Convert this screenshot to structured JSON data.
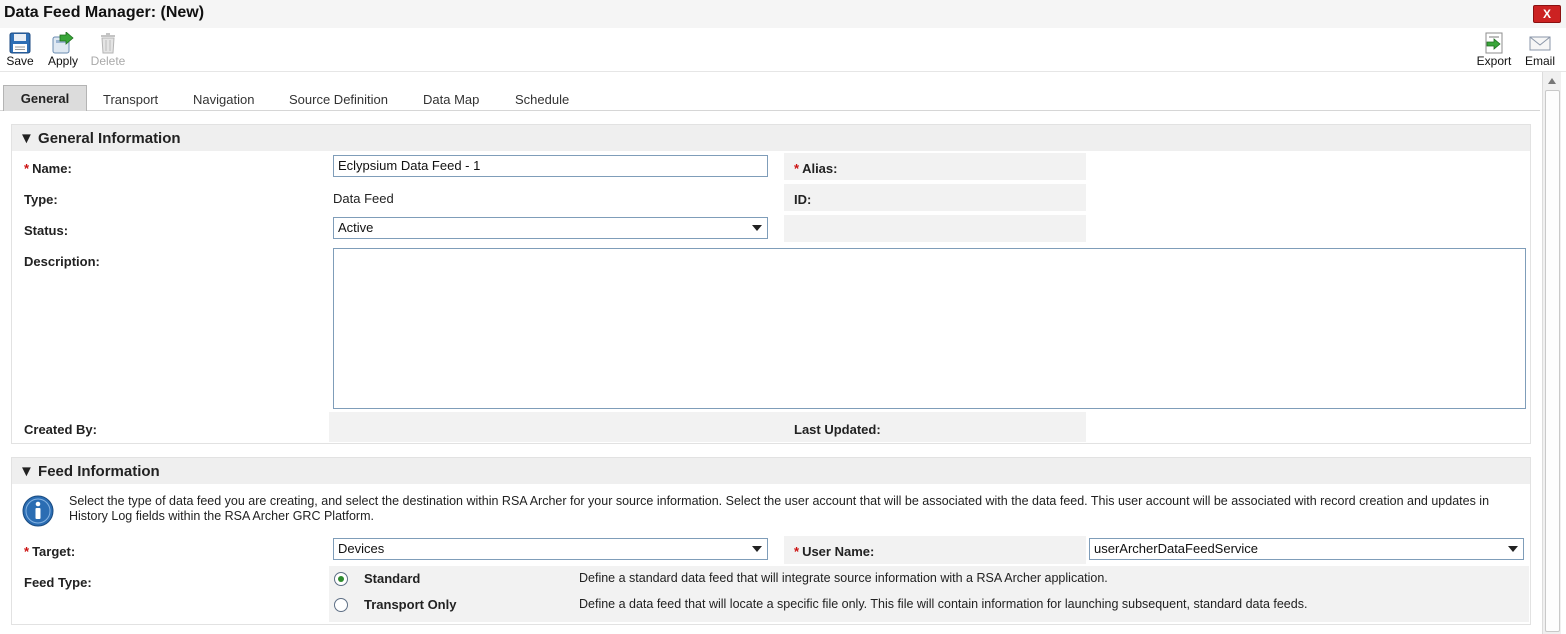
{
  "window": {
    "title": "Data Feed Manager: (New)",
    "close_label": "X"
  },
  "toolbar": {
    "save": "Save",
    "apply": "Apply",
    "delete": "Delete",
    "export": "Export",
    "email": "Email"
  },
  "tabs": [
    "General",
    "Transport",
    "Navigation",
    "Source Definition",
    "Data Map",
    "Schedule"
  ],
  "general_info": {
    "header": "General Information",
    "name_label": "Name:",
    "name_value": "Eclypsium Data Feed - 1",
    "alias_label": "Alias:",
    "type_label": "Type:",
    "type_value": "Data Feed",
    "id_label": "ID:",
    "status_label": "Status:",
    "status_value": "Active",
    "description_label": "Description:",
    "created_by_label": "Created By:",
    "last_updated_label": "Last Updated:"
  },
  "feed_info": {
    "header": "Feed Information",
    "info_text": "Select the type of data feed you are creating, and select the destination within RSA Archer for your source information. Select the user account that will be associated with the data feed. This user account will be associated with record creation and updates in History Log fields within the RSA Archer GRC Platform.",
    "target_label": "Target:",
    "target_value": "Devices",
    "username_label": "User Name:",
    "username_value": "userArcherDataFeedService",
    "feed_type_label": "Feed Type:",
    "options": [
      {
        "label": "Standard",
        "desc": "Define a standard data feed that will integrate source information with a RSA Archer application.",
        "selected": true
      },
      {
        "label": "Transport Only",
        "desc": "Define a data feed that will locate a specific file only. This file will contain information for launching subsequent, standard data feeds.",
        "selected": false
      }
    ]
  },
  "colors": {
    "required": "#cc1111",
    "radio_selected": "#2e8b2e",
    "close": "#cc2222"
  }
}
